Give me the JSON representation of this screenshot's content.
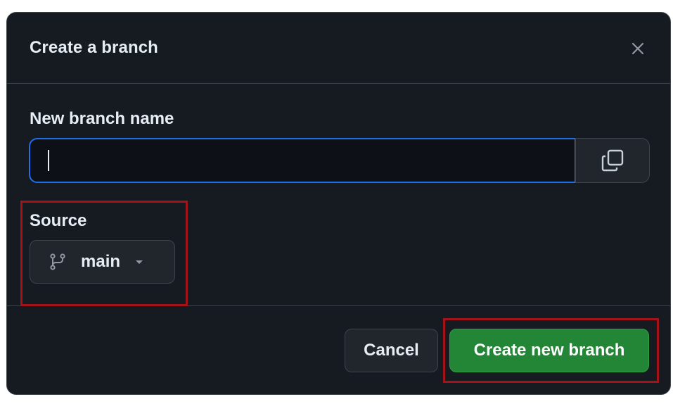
{
  "dialog": {
    "title": "Create a branch",
    "close_icon": "close-icon"
  },
  "new_branch": {
    "label": "New branch name",
    "value": "",
    "placeholder": "",
    "copy_icon": "copy-icon"
  },
  "source": {
    "label": "Source",
    "branch": "main",
    "branch_icon": "git-branch-icon",
    "dropdown_icon": "triangle-down-icon"
  },
  "footer": {
    "cancel_label": "Cancel",
    "create_label": "Create new branch"
  },
  "colors": {
    "background": "#161b22",
    "border": "#3d444d",
    "text": "#e6edf3",
    "focus": "#1f6feb",
    "primary": "#238636",
    "highlight": "#a4121a"
  }
}
